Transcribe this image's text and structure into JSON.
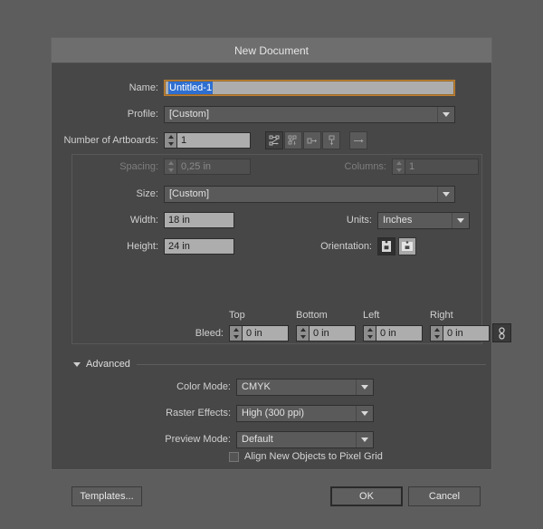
{
  "dialog": {
    "title": "New Document"
  },
  "name_row": {
    "label": "Name:",
    "value": "Untitled-1"
  },
  "profile_row": {
    "label": "Profile:",
    "value": "[Custom]"
  },
  "artboards_row": {
    "label": "Number of Artboards:",
    "value": "1",
    "icons": [
      "grid-by-row-icon",
      "grid-by-column-icon",
      "arrange-by-row-icon",
      "arrange-by-column-icon",
      "right-to-left-layout-icon"
    ]
  },
  "spacing_row": {
    "label": "Spacing:",
    "value": "0,25 in"
  },
  "columns_row": {
    "label": "Columns:",
    "value": "1"
  },
  "size_row": {
    "label": "Size:",
    "value": "[Custom]"
  },
  "width_row": {
    "label": "Width:",
    "value": "18 in"
  },
  "height_row": {
    "label": "Height:",
    "value": "24 in"
  },
  "units_row": {
    "label": "Units:",
    "value": "Inches"
  },
  "orientation_row": {
    "label": "Orientation:",
    "portrait_icon": "portrait-orientation-icon",
    "landscape_icon": "landscape-orientation-icon"
  },
  "bleed": {
    "label": "Bleed:",
    "headers": [
      "Top",
      "Bottom",
      "Left",
      "Right"
    ],
    "values": [
      "0 in",
      "0 in",
      "0 in",
      "0 in"
    ],
    "link_icon": "chain-link-icon"
  },
  "advanced": {
    "title": "Advanced",
    "color_mode": {
      "label": "Color Mode:",
      "value": "CMYK"
    },
    "raster_effects": {
      "label": "Raster Effects:",
      "value": "High (300 ppi)"
    },
    "preview_mode": {
      "label": "Preview Mode:",
      "value": "Default"
    },
    "align_pixel_grid": {
      "label": "Align New Objects to Pixel Grid",
      "checked": false
    }
  },
  "footer": {
    "templates": "Templates...",
    "ok": "OK",
    "cancel": "Cancel"
  },
  "colors": {
    "dialog_bg": "#474747",
    "titlebar_bg": "#6e6e6e",
    "backdrop": "#5d5d5d",
    "input_bg": "#adadad",
    "focus_border": "#c08030",
    "selection_blue": "#2f6fd0"
  }
}
